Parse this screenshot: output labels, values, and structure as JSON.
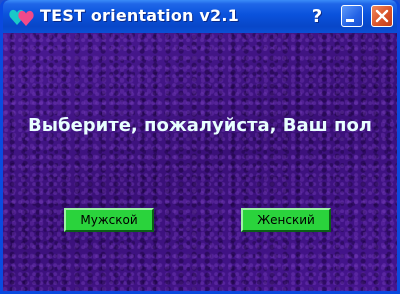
{
  "window": {
    "title": "TEST orientation v2.1",
    "help_label": "?",
    "app_icon": "hearts-icon"
  },
  "colors": {
    "titlebar": "#0a52dc",
    "client_background": "#3f1382",
    "prompt_text": "#e8ffff",
    "button_green": "#2ad33c",
    "close_red": "#d9532a"
  },
  "main": {
    "prompt": "Выберите, пожалуйста, Ваш пол",
    "male_button": "Мужской",
    "female_button": "Женский"
  }
}
